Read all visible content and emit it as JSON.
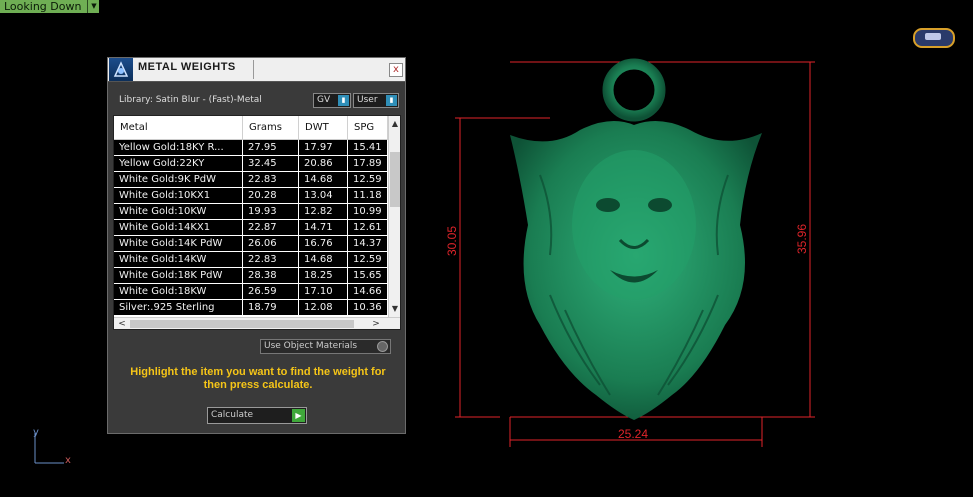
{
  "viewport": {
    "label": "Looking Down",
    "dims": {
      "height_inner": "30.05",
      "height_outer": "35.96",
      "width": "25.24"
    },
    "axes": {
      "y": "y",
      "x": "x"
    }
  },
  "dialog": {
    "title": "METAL WEIGHTS",
    "close_label": "x",
    "library_text": "Library: Satin Blur - (Fast)-Metal",
    "gv_label": "GV",
    "user_label": "User",
    "columns": [
      "Metal",
      "Grams",
      "DWT",
      "SPG"
    ],
    "rows": [
      [
        "Yellow Gold:18KY R...",
        "27.95",
        "17.97",
        "15.41"
      ],
      [
        "Yellow Gold:22KY",
        "32.45",
        "20.86",
        "17.89"
      ],
      [
        "White Gold:9K PdW",
        "22.83",
        "14.68",
        "12.59"
      ],
      [
        "White Gold:10KX1",
        "20.28",
        "13.04",
        "11.18"
      ],
      [
        "White Gold:10KW",
        "19.93",
        "12.82",
        "10.99"
      ],
      [
        "White Gold:14KX1",
        "22.87",
        "14.71",
        "12.61"
      ],
      [
        "White Gold:14K PdW",
        "26.06",
        "16.76",
        "14.37"
      ],
      [
        "White Gold:14KW",
        "22.83",
        "14.68",
        "12.59"
      ],
      [
        "White Gold:18K PdW",
        "28.38",
        "18.25",
        "15.65"
      ],
      [
        "White Gold:18KW",
        "26.59",
        "17.10",
        "14.66"
      ],
      [
        "Silver:.925 Sterling",
        "18.79",
        "12.08",
        "10.36"
      ]
    ],
    "use_object_materials": "Use Object Materials",
    "hint": "Highlight the item you want to find the weight for then press calculate.",
    "calculate_label": "Calculate"
  },
  "colors": {
    "model": "#1f8a5a",
    "dimension": "#e0242a",
    "hint": "#f5c518"
  }
}
